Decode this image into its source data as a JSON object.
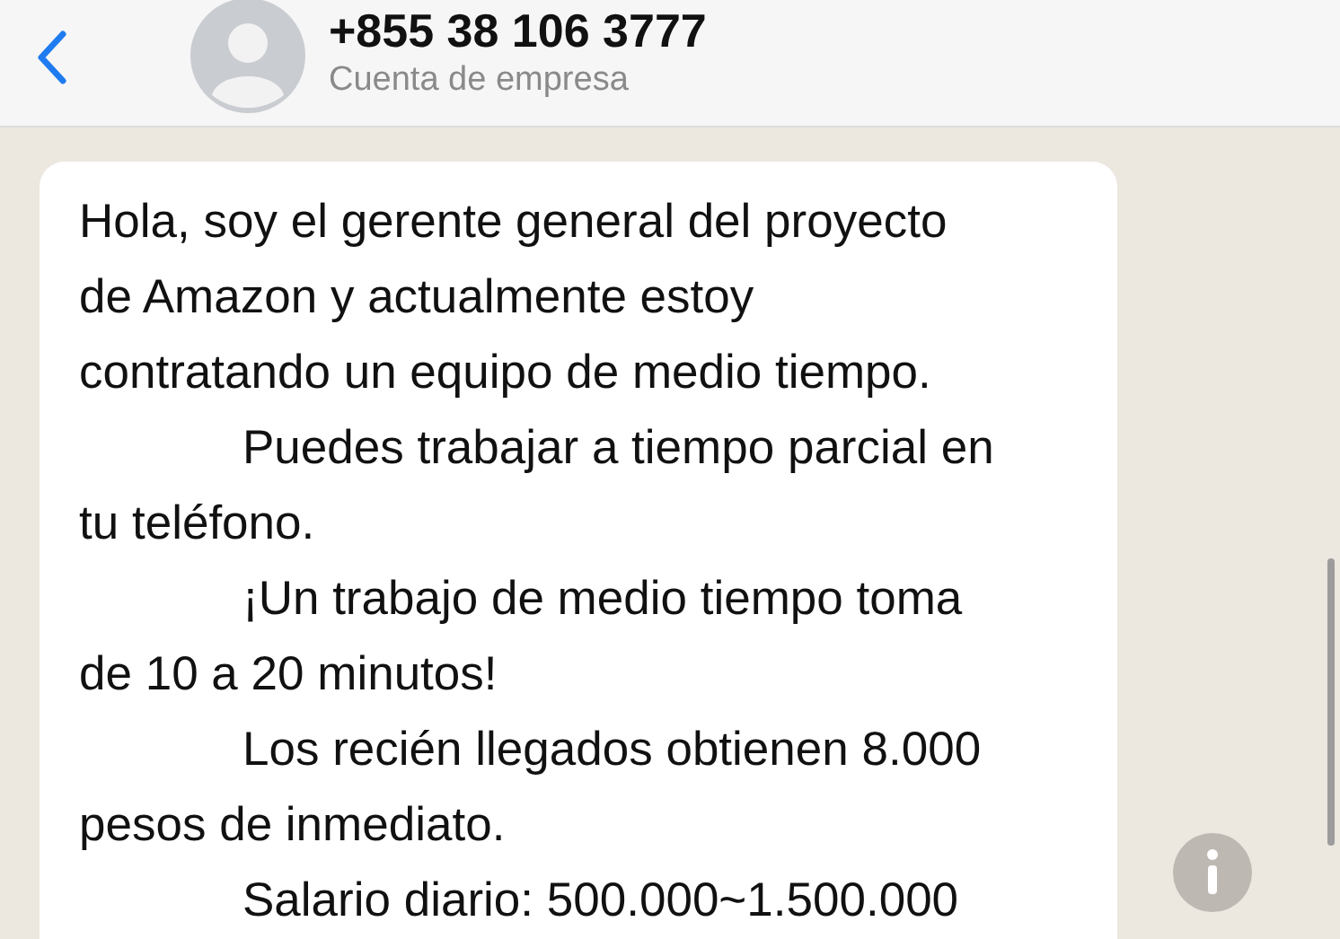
{
  "header": {
    "title": "+855 38 106 3777",
    "subtitle": "Cuenta de empresa"
  },
  "message": {
    "paragraphs": [
      {
        "indent": false,
        "lines": [
          "Hola, soy el gerente general del proyecto",
          "de Amazon y actualmente estoy",
          "contratando un equipo de medio tiempo."
        ]
      },
      {
        "indent": true,
        "lines": [
          "Puedes trabajar a tiempo parcial en",
          "tu teléfono."
        ]
      },
      {
        "indent": true,
        "lines": [
          "¡Un trabajo de medio tiempo toma",
          "de 10 a 20 minutos!"
        ]
      },
      {
        "indent": true,
        "lines": [
          "Los recién llegados obtienen 8.000",
          "pesos de inmediato."
        ]
      },
      {
        "indent": true,
        "lines": [
          "Salario diario: 500.000~1.500.000"
        ]
      }
    ]
  }
}
